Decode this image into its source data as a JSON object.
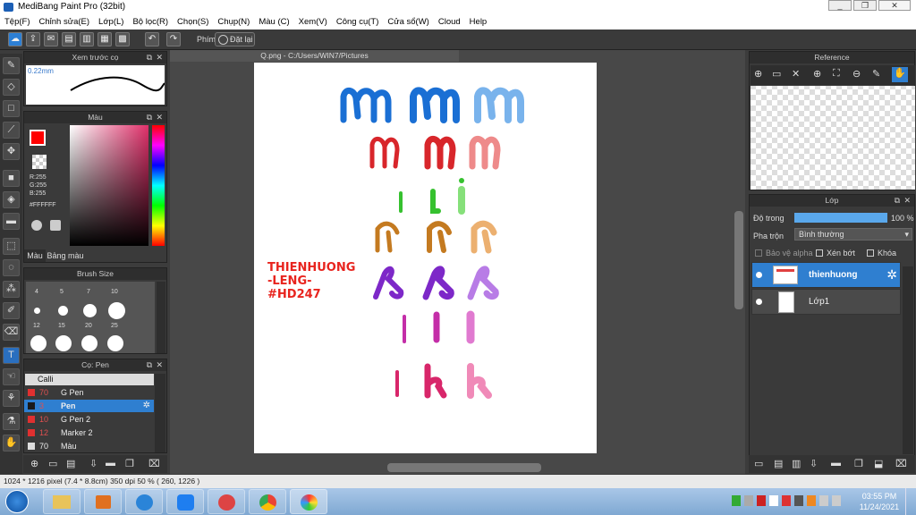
{
  "window": {
    "title": "MediBang Paint Pro (32bit)",
    "min": "_",
    "max": "❐",
    "close": "✕"
  },
  "menu": [
    "Tệp(F)",
    "Chỉnh sửa(E)",
    "Lớp(L)",
    "Bộ lọc(R)",
    "Chọn(S)",
    "Chụp(N)",
    "Màu (C)",
    "Xem(V)",
    "Công cụ(T)",
    "Cửa sổ(W)",
    "Cloud",
    "Help"
  ],
  "toolbar": {
    "key_label": "Phím",
    "reset_label": "Đặt lại"
  },
  "panels": {
    "preview": {
      "title": "Xem trước cọ",
      "size": "0.22mm"
    },
    "color": {
      "title": "Màu",
      "r": "R:255",
      "g": "G:255",
      "b": "B:255",
      "hex": "#FFFFFF",
      "tab1": "Màu",
      "tab2": "Bảng màu",
      "primary": "#ff0000"
    },
    "brush_size": {
      "title": "Brush Size",
      "sizes": [
        "4",
        "5",
        "7",
        "10",
        "12",
        "15",
        "20",
        "25"
      ]
    },
    "brush": {
      "title": "Cọ: Pen",
      "group": "Calli",
      "items": [
        {
          "size": "70",
          "name": "G Pen",
          "color": "#e03030"
        },
        {
          "size": "3",
          "name": "Pen",
          "color": "#1a1a1a"
        },
        {
          "size": "10",
          "name": "G Pen 2",
          "color": "#e03030"
        },
        {
          "size": "12",
          "name": "Marker 2",
          "color": "#e03030"
        },
        {
          "size": "70",
          "name": "Màu",
          "color": "#dddddd"
        }
      ]
    },
    "reference": {
      "title": "Reference"
    },
    "layers": {
      "title": "Lớp",
      "opacity_label": "Độ trong",
      "opacity_value": "100 %",
      "opacity": 1.0,
      "blend_label": "Pha trộn",
      "blend_value": "Bình thường",
      "protect_alpha": "Bảo vệ alpha",
      "clipping": "Xén bớt",
      "lock": "Khóa",
      "items": [
        {
          "name": "thienhuong"
        },
        {
          "name": "Lớp1"
        }
      ]
    }
  },
  "document": {
    "tab": "Q.png - C:/Users/WIN7/Pictures",
    "signature": [
      "THIENHUONG",
      "-LENG-",
      "#HD247"
    ],
    "glyph_rows": [
      "m",
      "n",
      "i",
      "r",
      "s",
      "l",
      "k"
    ],
    "glyph_colors": [
      "#1a6fd4",
      "#d8262b",
      "#36c12f",
      "#c47a20",
      "#7d28c8",
      "#c42ea8",
      "#d8266a"
    ]
  },
  "status": "1024 * 1216 pixel   (7.4 * 8.8cm)   350 dpi   50 %   ( 260, 1226 )",
  "clock": {
    "time": "03:55 PM",
    "date": "11/24/2021"
  }
}
